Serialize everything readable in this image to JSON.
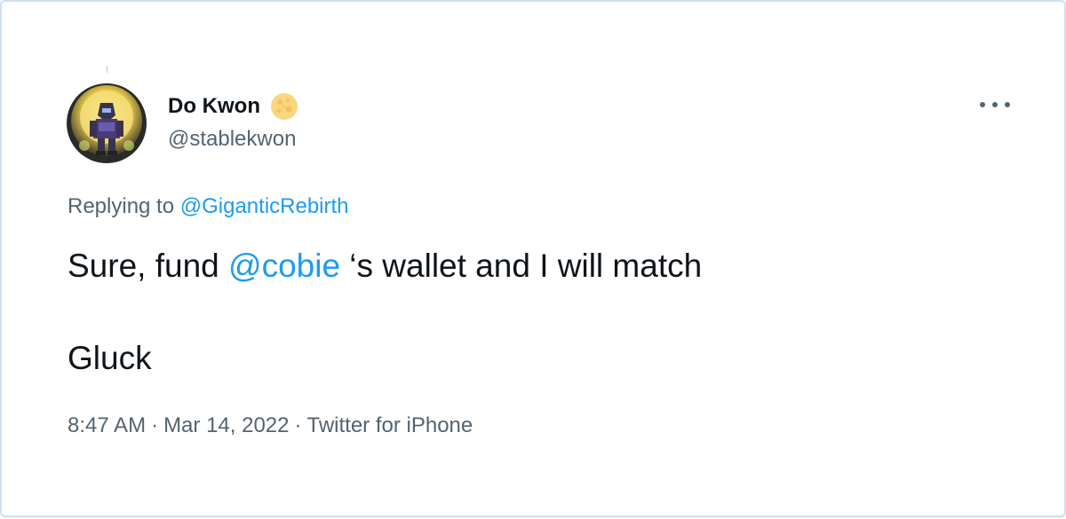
{
  "author": {
    "name": "Do Kwon",
    "handle": "@stablekwon",
    "avatar_icon": "avatar-icon",
    "badge_icon": "moon-emoji-icon"
  },
  "replying": {
    "prefix": "Replying to",
    "to_handle": "@GiganticRebirth"
  },
  "tweet": {
    "line1_before": "Sure, fund ",
    "mention": "@cobie",
    "line1_after": " ‘s wallet and I will match",
    "line2": "Gluck"
  },
  "meta": {
    "time": "8:47 AM",
    "separator": "·",
    "date": "Mar 14, 2022",
    "source": "Twitter for iPhone"
  },
  "more_icon": "more-options-icon",
  "colors": {
    "link": "#1d9bf0",
    "text": "#0f1419",
    "secondary": "#536471",
    "border": "#cfe0f3"
  }
}
